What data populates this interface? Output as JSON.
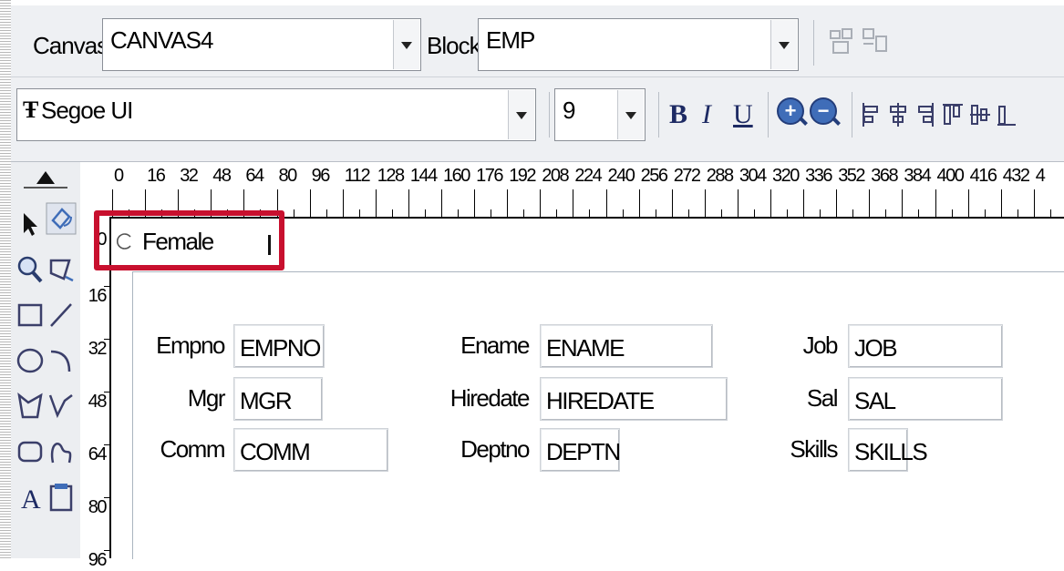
{
  "toolbar": {
    "canvas_label": "Canvas:",
    "canvas_value": "CANVAS4",
    "block_label": "Block:",
    "block_value": "EMP",
    "font_value": "Segoe UI",
    "font_size_value": "9",
    "bold_label": "B",
    "italic_label": "I",
    "underline_label": "U",
    "zoom_in_label": "+",
    "zoom_out_label": "−"
  },
  "ruler": {
    "horizontal": [
      "0",
      "16",
      "32",
      "48",
      "64",
      "80",
      "96",
      "112",
      "128",
      "144",
      "160",
      "176",
      "192",
      "208",
      "224",
      "240",
      "256",
      "272",
      "288",
      "304",
      "320",
      "336",
      "352",
      "368",
      "384",
      "400",
      "416",
      "432",
      "4"
    ],
    "vertical": [
      "0",
      "16",
      "32",
      "48",
      "64",
      "80",
      "96"
    ]
  },
  "canvas": {
    "radio_label": "Female",
    "fields": [
      {
        "label": "Empno",
        "value": "EMPNO"
      },
      {
        "label": "Mgr",
        "value": "MGR"
      },
      {
        "label": "Comm",
        "value": "COMM"
      },
      {
        "label": "Ename",
        "value": "ENAME"
      },
      {
        "label": "Hiredate",
        "value": "HIREDATE"
      },
      {
        "label": "Deptno",
        "value": "DEPTN"
      },
      {
        "label": "Job",
        "value": "JOB"
      },
      {
        "label": "Sal",
        "value": "SAL"
      },
      {
        "label": "Skills",
        "value": "SKILLS"
      }
    ]
  },
  "palette": {
    "tools": [
      "select-arrow-icon",
      "rotate-icon",
      "magnify-icon",
      "reshape-icon",
      "rectangle-icon",
      "line-icon",
      "ellipse-icon",
      "arc-icon",
      "polygon-icon",
      "polyline-icon",
      "rounded-rectangle-icon",
      "freehand-icon",
      "text-icon",
      "frame-icon"
    ]
  },
  "colors": {
    "highlight": "#c8102e",
    "toolbar_bg": "#eef0f3",
    "icon_blue": "#3f6db8"
  }
}
